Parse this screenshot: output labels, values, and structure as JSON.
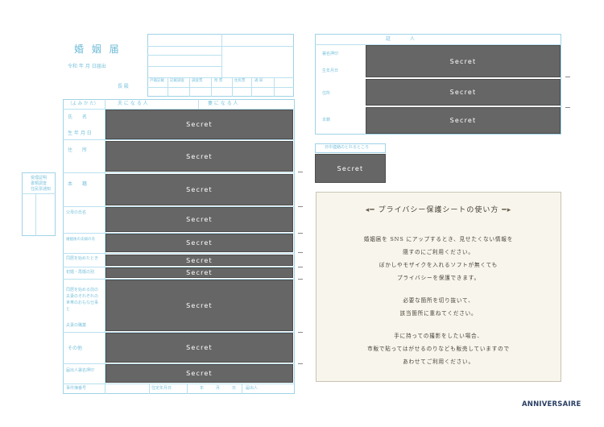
{
  "form": {
    "title": "婚 姻 届",
    "date_label": "令和   年   月   日届出",
    "mayor_label": "長 殿",
    "section_husband": "夫 に な る 人",
    "section_wife": "妻 に な る 人",
    "reading": "（よ み か た）",
    "rows": [
      "氏　　名",
      "生 年 月 日",
      "住　　所",
      "本　　籍",
      "父母の氏名",
      "婚姻後の夫婦の氏",
      "同居を始めたとき",
      "初婚・再婚の別",
      "同居を始める前の夫妻のそれぞれの世帯のおもな仕事と",
      "夫妻の職業",
      "その他",
      "届出人署名押印",
      "事件簿番号"
    ],
    "left_box": [
      "受理証明",
      "書類調査",
      "住民票通知"
    ],
    "office_cells": [
      "戸籍記載",
      "記載調査",
      "調査票",
      "附 票",
      "住民票",
      "通 知"
    ],
    "bottom_labels": [
      "住定年月日",
      "年",
      "月",
      "日",
      "届出人"
    ]
  },
  "witness": {
    "header": "証　　人",
    "labels": [
      "署名押印",
      "生年月日",
      "住所",
      "本籍"
    ]
  },
  "fields": {
    "secret_label": "Secret"
  },
  "stamp_header": "日中連絡のとれるところ",
  "guide": {
    "title": "プライバシー保護シートの使い方",
    "paragraphs": [
      [
        "婚姻届を SNS にアップするとき、見せたくない情報を",
        "隠すのにご利用ください。",
        "ぼかしやモザイクを入れるソフトが無くても",
        "プライバシーを保護できます。"
      ],
      [
        "必要な箇所を切り抜いて、",
        "該当箇所に重ねてください。"
      ],
      [
        "手に持っての撮影をしたい場合、",
        "市販で貼ってはがせるのりなども販売していますので",
        "あわせてご利用ください。"
      ]
    ]
  },
  "brand": {
    "logo_text": "ANNIVERSAIRE"
  }
}
